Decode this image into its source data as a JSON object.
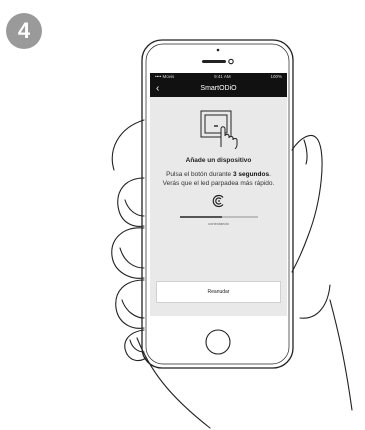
{
  "step": {
    "number": "4"
  },
  "status_bar": {
    "carrier": "•••• Movis",
    "time": "9:41 AM",
    "battery": "100%"
  },
  "nav": {
    "back_glyph": "‹",
    "app_title": "SmartODiO"
  },
  "setup": {
    "title": "Añade un dispositivo",
    "instruction_part1": "Pulsa el botón durante ",
    "instruction_bold": "3 segundos",
    "instruction_part2": ". Verás que el led parpadea más rápido.",
    "progress_fraction": 0.55,
    "progress_label": "conectando",
    "resume_button": "Reanudar"
  },
  "colors": {
    "screen_bg": "#e9e9e9",
    "bars_bg": "#111111",
    "badge_bg": "#9a9a9a"
  },
  "icons": [
    "device-switch-icon",
    "finger-press-icon",
    "connecting-icon",
    "back-arrow-icon"
  ]
}
